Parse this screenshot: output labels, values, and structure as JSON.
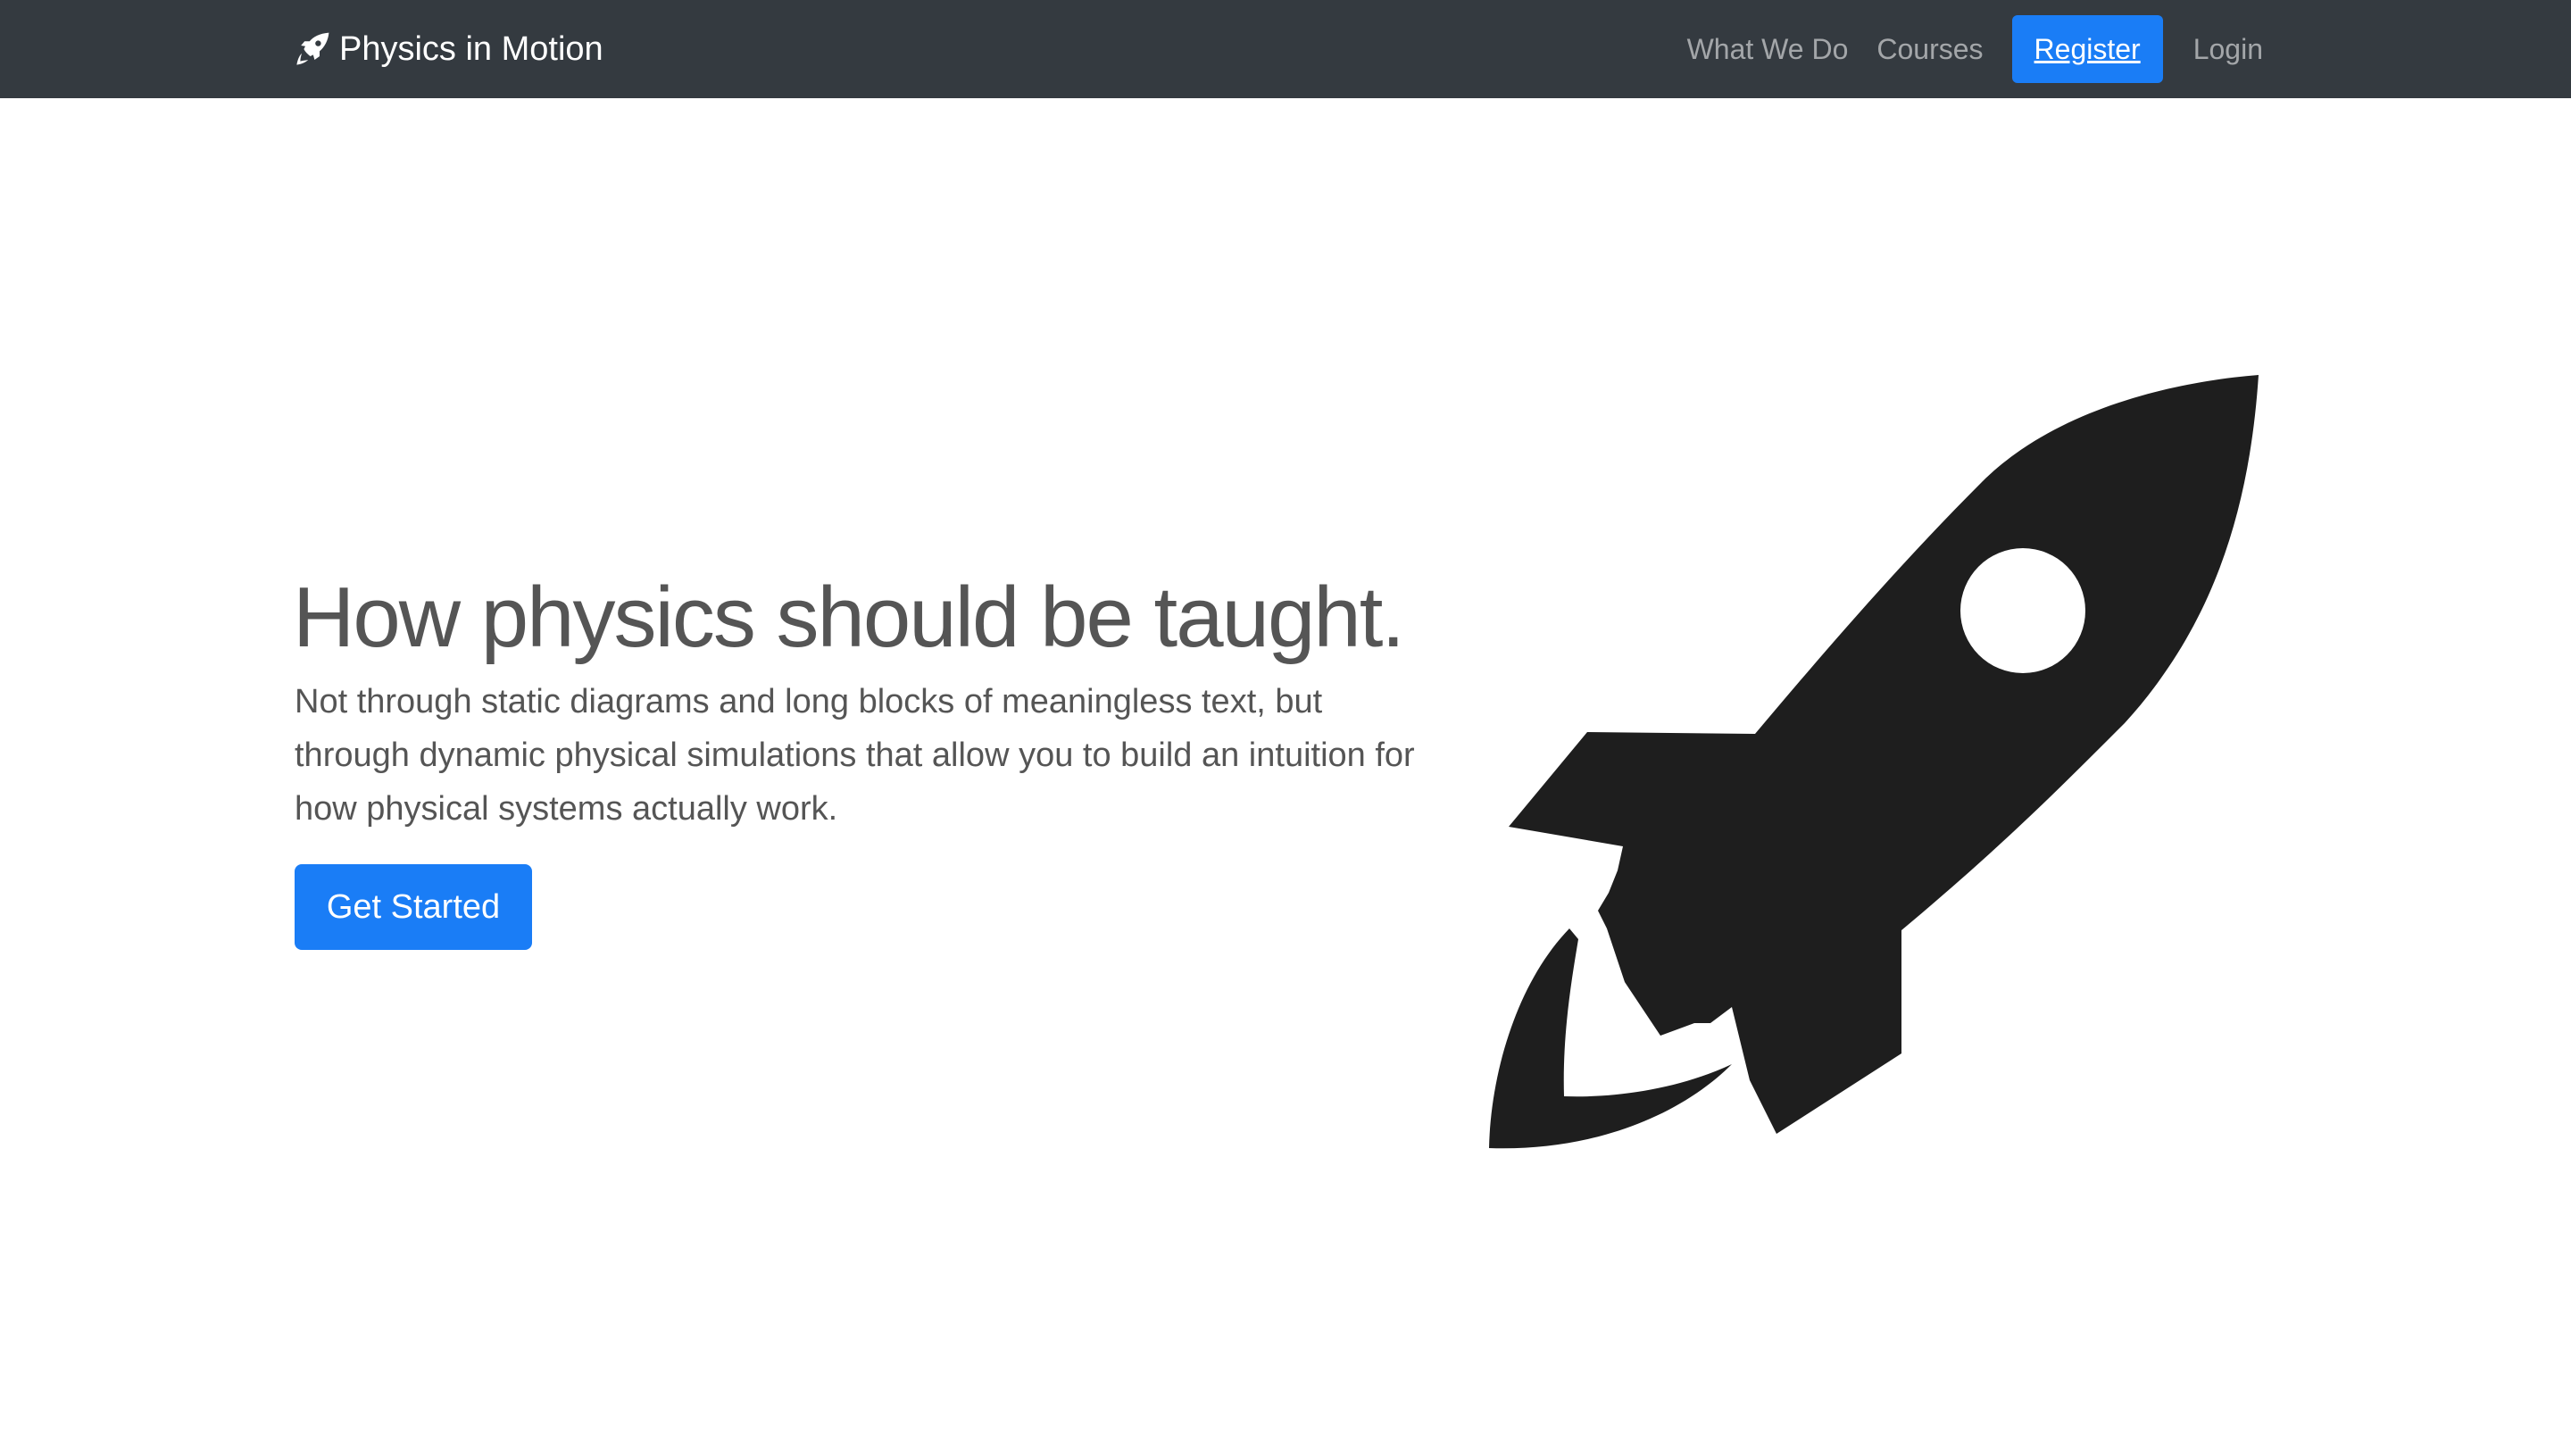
{
  "navbar": {
    "brand_label": "Physics in Motion",
    "brand_icon": "rocket-icon",
    "links": {
      "what_we_do": "What We Do",
      "courses": "Courses",
      "register": "Register",
      "login": "Login"
    }
  },
  "hero": {
    "title": "How physics should be taught.",
    "text": "Not through static diagrams and long blocks of meaningless text, but through dynamic physical simulations that allow you to build an intuition for how physical systems actually work.",
    "cta_label": "Get Started",
    "illustration_icon": "rocket-icon"
  },
  "colors": {
    "navbar_bg": "#343a40",
    "accent": "#1a7df6",
    "text": "#555555",
    "rocket": "#1e1e1e"
  }
}
